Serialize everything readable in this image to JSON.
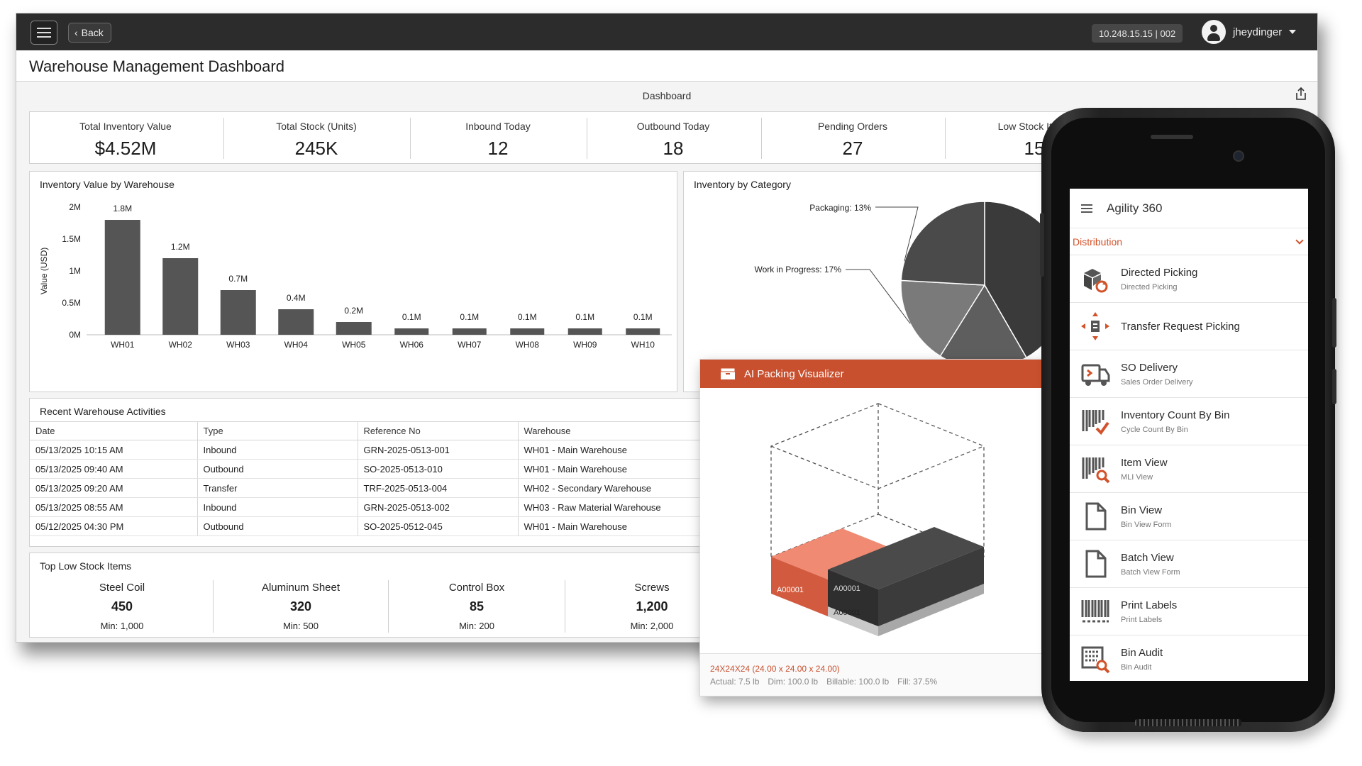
{
  "topbar": {
    "back_label": "Back",
    "ip": "10.248.15.15 | 002",
    "user": "jheydinger"
  },
  "page": {
    "title": "Warehouse Management Dashboard",
    "tab_label": "Dashboard"
  },
  "kpis": [
    {
      "label": "Total Inventory Value",
      "value": "$4.52M"
    },
    {
      "label": "Total Stock (Units)",
      "value": "245K"
    },
    {
      "label": "Inbound Today",
      "value": "12"
    },
    {
      "label": "Outbound Today",
      "value": "18"
    },
    {
      "label": "Pending Orders",
      "value": "27"
    },
    {
      "label": "Low Stock Items",
      "value": "15"
    }
  ],
  "chart_data": [
    {
      "type": "bar",
      "title": "Inventory Value by Warehouse",
      "xlabel": "",
      "ylabel": "Value (USD)",
      "categories": [
        "WH01",
        "WH02",
        "WH03",
        "WH04",
        "WH05",
        "WH06",
        "WH07",
        "WH08",
        "WH09",
        "WH10"
      ],
      "values": [
        1.8,
        1.2,
        0.7,
        0.4,
        0.2,
        0.1,
        0.1,
        0.1,
        0.1,
        0.1
      ],
      "value_labels": [
        "1.8M",
        "1.2M",
        "0.7M",
        "0.4M",
        "0.2M",
        "0.1M",
        "0.1M",
        "0.1M",
        "0.1M",
        "0.1M"
      ],
      "yticks": [
        "0M",
        "0.5M",
        "1M",
        "1.5M",
        "2M"
      ],
      "ylim": [
        0,
        2
      ],
      "unit": "M",
      "color": "#555555"
    },
    {
      "type": "pie",
      "title": "Inventory by Category",
      "labels": [
        "Packaging: 13%",
        "Work in Progress: 17%"
      ],
      "slices": [
        {
          "label": "Packaging",
          "value": 13,
          "color": "#4a4a4a"
        },
        {
          "label": "Work in Progress",
          "value": 17,
          "color": "#7a7a7a"
        }
      ],
      "note": "remaining slices hidden behind the phone overlay"
    }
  ],
  "activities": {
    "title": "Recent Warehouse Activities",
    "columns": [
      "Date",
      "Type",
      "Reference No",
      "Warehouse"
    ],
    "rows": [
      [
        "05/13/2025  10:15 AM",
        "Inbound",
        "GRN-2025-0513-001",
        "WH01 - Main Warehouse"
      ],
      [
        "05/13/2025  09:40 AM",
        "Outbound",
        "SO-2025-0513-010",
        "WH01 - Main Warehouse"
      ],
      [
        "05/13/2025  09:20 AM",
        "Transfer",
        "TRF-2025-0513-004",
        "WH02 - Secondary Warehouse"
      ],
      [
        "05/13/2025  08:55 AM",
        "Inbound",
        "GRN-2025-0513-002",
        "WH03 - Raw Material Warehouse"
      ],
      [
        "05/12/2025  04:30 PM",
        "Outbound",
        "SO-2025-0512-045",
        "WH01 - Main Warehouse"
      ]
    ]
  },
  "low_stock": {
    "title": "Top Low Stock Items",
    "items": [
      {
        "name": "Steel Coil",
        "qty": "450",
        "min": "Min: 1,000"
      },
      {
        "name": "Aluminum Sheet",
        "qty": "320",
        "min": "Min: 500"
      },
      {
        "name": "Control Box",
        "qty": "85",
        "min": "Min: 200"
      },
      {
        "name": "Screws",
        "qty": "1,200",
        "min": "Min: 2,000"
      }
    ]
  },
  "packer": {
    "title": "AI Packing Visualizer",
    "box_labels": [
      "A00001",
      "A00001",
      "A00001"
    ],
    "size": "24X24X24 (24.00 x 24.00 x 24.00)",
    "stats": [
      "Actual: 7.5 lb",
      "Dim: 100.0 lb",
      "Billable: 100.0 lb",
      "Fill: 37.5%"
    ],
    "accent": "#c8502f"
  },
  "mobile": {
    "app_title": "Agility 360",
    "section": "Distribution",
    "accent": "#d2522a",
    "items": [
      {
        "title": "Directed Picking",
        "subtitle": "Directed Picking",
        "icon": "box-refresh-icon"
      },
      {
        "title": "Transfer Request Picking",
        "subtitle": "",
        "icon": "transfer-arrows-icon"
      },
      {
        "title": "SO Delivery",
        "subtitle": "Sales Order Delivery",
        "icon": "delivery-truck-icon"
      },
      {
        "title": "Inventory Count By Bin",
        "subtitle": "Cycle Count By Bin",
        "icon": "barcode-check-icon"
      },
      {
        "title": "Item View",
        "subtitle": "MLI View",
        "icon": "barcode-search-icon"
      },
      {
        "title": "Bin View",
        "subtitle": "Bin View Form",
        "icon": "document-icon"
      },
      {
        "title": "Batch View",
        "subtitle": "Batch View Form",
        "icon": "document-icon"
      },
      {
        "title": "Print Labels",
        "subtitle": "Print Labels",
        "icon": "barcode-icon"
      },
      {
        "title": "Bin Audit",
        "subtitle": "Bin Audit",
        "icon": "bin-audit-icon"
      }
    ]
  }
}
